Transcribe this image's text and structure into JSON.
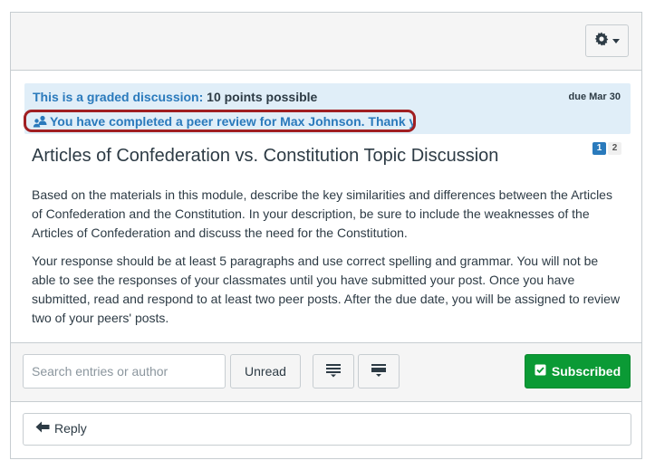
{
  "header": {
    "settings_icon": "gear-icon",
    "menu_icon": "caret-down-icon"
  },
  "graded": {
    "lead": "This is a graded discussion:",
    "points": "10 points possible",
    "due": "due Mar 30"
  },
  "peer_review": {
    "icon": "peer-review-icon",
    "message": "You have completed a peer review for Max Johnson. Thank you"
  },
  "topic": {
    "title": "Articles of Confederation vs. Constitution Topic Discussion",
    "pages": [
      "1",
      "2"
    ],
    "paragraphs": [
      "Based on the materials in this module, describe the key similarities and differences between the Articles of Confederation and the Constitution. In your description, be sure to include the weaknesses of the Articles of Confederation and discuss the need for the Constitution.",
      "Your response should be at least 5 paragraphs and use correct spelling and grammar. You will not be able to see the responses of your classmates until you have submitted your post. Once you have submitted, read and respond to at least two peer posts. After the due date, you will be assigned to review two of your peers' posts."
    ]
  },
  "toolbar": {
    "search_placeholder": "Search entries or author",
    "unread_label": "Unread",
    "collapse_icon": "collapse-threads-icon",
    "expand_icon": "expand-threads-icon",
    "subscribed_label": "Subscribed",
    "subscribed_icon": "checkbox-icon"
  },
  "reply": {
    "label": "Reply",
    "icon": "reply-arrow-icon"
  },
  "colors": {
    "accent_blue": "#2a7abc",
    "highlight_border": "#a01f22",
    "subscribed_green": "#0b9a35",
    "info_bar": "#e0eef8"
  }
}
